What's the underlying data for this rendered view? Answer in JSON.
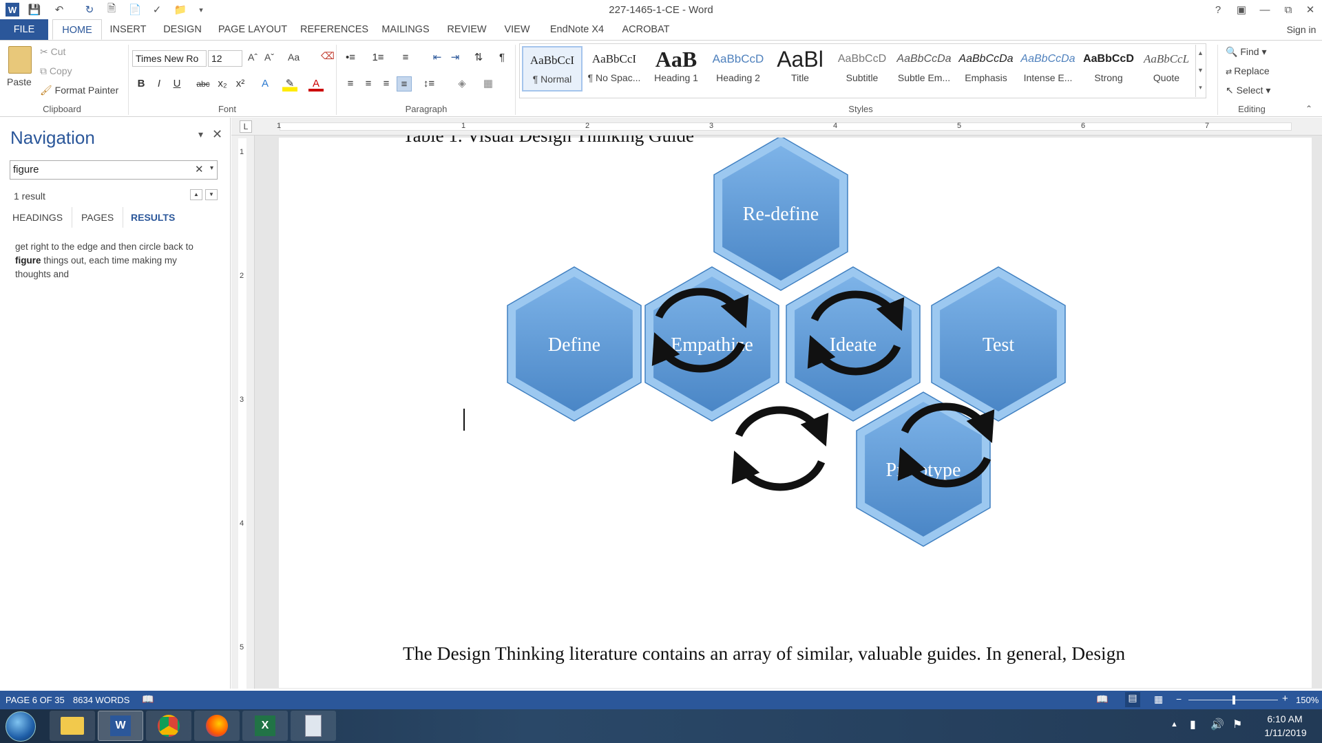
{
  "window": {
    "title": "227-1465-1-CE - Word",
    "help": "?",
    "sign_in": "Sign in"
  },
  "tabs": [
    "FILE",
    "HOME",
    "INSERT",
    "DESIGN",
    "PAGE LAYOUT",
    "REFERENCES",
    "MAILINGS",
    "REVIEW",
    "VIEW",
    "EndNote X4",
    "ACROBAT"
  ],
  "ribbon": {
    "clipboard": {
      "paste": "Paste",
      "cut": "Cut",
      "copy": "Copy",
      "format_painter": "Format Painter",
      "label": "Clipboard"
    },
    "font": {
      "name": "Times New Ro",
      "size": "12",
      "label": "Font",
      "grow": "Aˆ",
      "shrink": "Aˇ",
      "case": "Aa",
      "bold": "B",
      "italic": "I",
      "underline": "U",
      "strike": "abc",
      "sub": "x₂",
      "sup": "x²"
    },
    "paragraph": {
      "label": "Paragraph",
      "pilcrow": "¶"
    },
    "styles": {
      "label": "Styles",
      "items": [
        {
          "sample": "AaBbCcI",
          "name": "¶ Normal"
        },
        {
          "sample": "AaBbCcI",
          "name": "¶ No Spac..."
        },
        {
          "sample": "AaB",
          "name": "Heading 1"
        },
        {
          "sample": "AaBbCcD",
          "name": "Heading 2"
        },
        {
          "sample": "AaBl",
          "name": "Title"
        },
        {
          "sample": "AaBbCcD",
          "name": "Subtitle"
        },
        {
          "sample": "AaBbCcDa",
          "name": "Subtle Em..."
        },
        {
          "sample": "AaBbCcDa",
          "name": "Emphasis"
        },
        {
          "sample": "AaBbCcDa",
          "name": "Intense E..."
        },
        {
          "sample": "AaBbCcD",
          "name": "Strong"
        },
        {
          "sample": "AaBbCcL",
          "name": "Quote"
        }
      ]
    },
    "editing": {
      "find": "Find",
      "replace": "Replace",
      "select": "Select",
      "label": "Editing"
    }
  },
  "navigation": {
    "title": "Navigation",
    "search_value": "figure",
    "result_count": "1 result",
    "tabs": [
      "HEADINGS",
      "PAGES",
      "RESULTS"
    ],
    "result_before": "get right to the edge and then circle back to ",
    "result_match": "figure",
    "result_after": " things out, each time making my thoughts and"
  },
  "ruler": {
    "h_ticks": [
      "1",
      "1",
      "2",
      "3",
      "4",
      "5",
      "6",
      "7"
    ],
    "v_ticks": [
      "1",
      "2",
      "3",
      "4",
      "5"
    ]
  },
  "document": {
    "heading_partial": "Table 1. Visual Design Thinking Guide",
    "hexagons": [
      "Re-define",
      "Define",
      "Empathize",
      "Ideate",
      "Test",
      "Prototype"
    ],
    "body_text": "The Design Thinking literature contains an array of similar, valuable guides. In general, Design"
  },
  "status": {
    "page": "PAGE 6 OF 35",
    "words": "8634 WORDS",
    "zoom": "150%"
  },
  "taskbar": {
    "time": "6:10 AM",
    "date": "1/11/2019"
  },
  "colors": {
    "accent": "#2b579a",
    "hex_fill": "#5b9bd5",
    "hex_dark": "#3f7fc0"
  }
}
